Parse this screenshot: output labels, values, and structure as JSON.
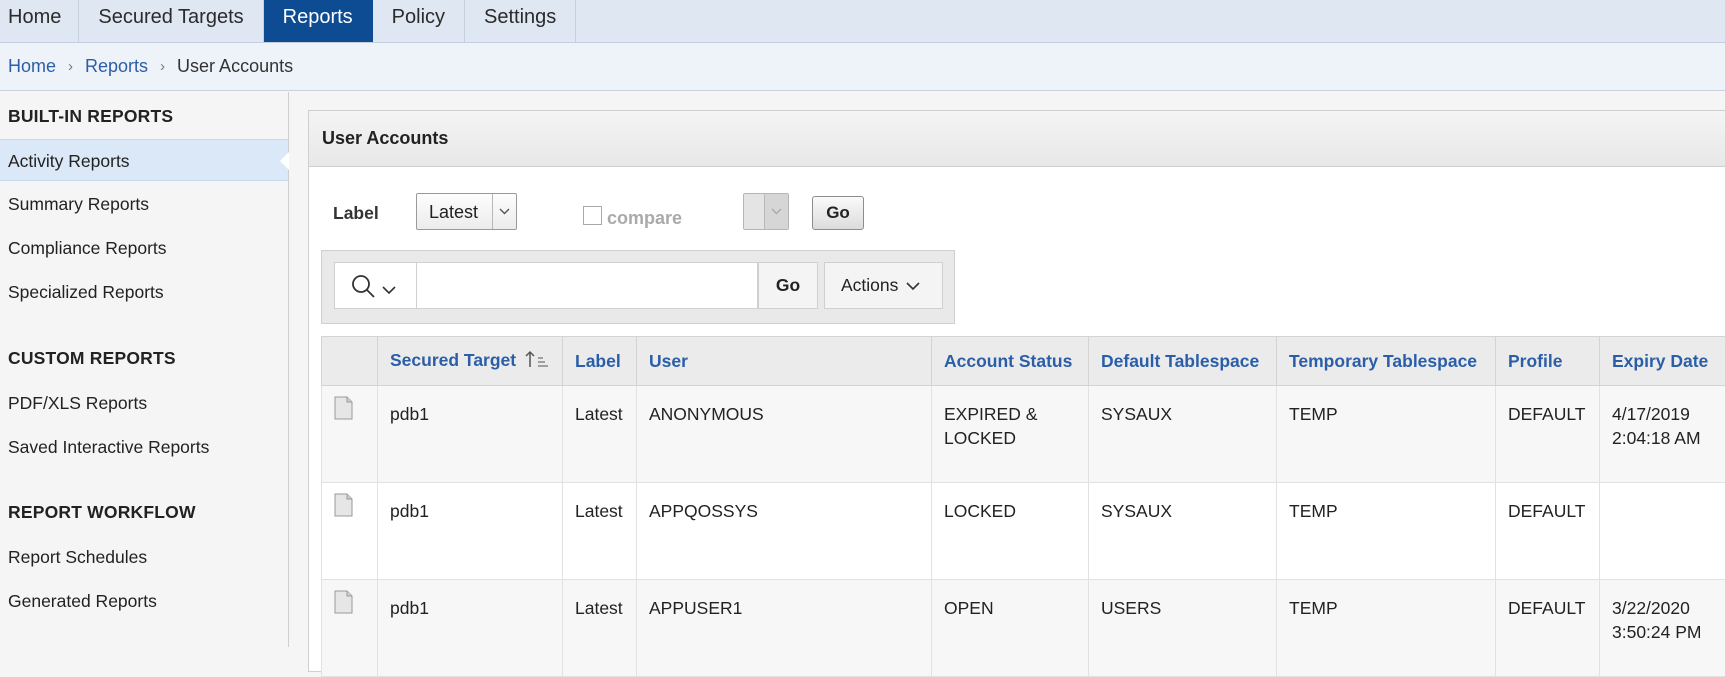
{
  "nav": {
    "tabs": [
      {
        "label": "Home"
      },
      {
        "label": "Secured Targets"
      },
      {
        "label": "Reports"
      },
      {
        "label": "Policy"
      },
      {
        "label": "Settings"
      }
    ]
  },
  "breadcrumb": {
    "home": "Home",
    "reports": "Reports",
    "current": "User Accounts",
    "separator": "›"
  },
  "sidebar": {
    "builtin_heading": "BUILT-IN REPORTS",
    "builtin_items": [
      "Activity Reports",
      "Summary Reports",
      "Compliance Reports",
      "Specialized Reports"
    ],
    "custom_heading": "CUSTOM REPORTS",
    "custom_items": [
      "PDF/XLS Reports",
      "Saved Interactive Reports"
    ],
    "workflow_heading": "REPORT WORKFLOW",
    "workflow_items": [
      "Report Schedules",
      "Generated Reports"
    ]
  },
  "region": {
    "title": "User Accounts",
    "label_text": "Label",
    "label_value": "Latest",
    "compare_label": "compare",
    "go_label": "Go"
  },
  "search": {
    "go_label": "Go",
    "actions_label": "Actions",
    "icon": "search-icon"
  },
  "table": {
    "columns": [
      "Secured Target",
      "Label",
      "User",
      "Account Status",
      "Default Tablespace",
      "Temporary Tablespace",
      "Profile",
      "Expiry Date"
    ],
    "rows": [
      {
        "target": "pdb1",
        "label": "Latest",
        "user": "ANONYMOUS",
        "status_line1": "EXPIRED &",
        "status_line2": "LOCKED",
        "default_ts": "SYSAUX",
        "temp_ts": "TEMP",
        "profile": "DEFAULT",
        "expiry_line1": "4/17/2019",
        "expiry_line2": "2:04:18 AM"
      },
      {
        "target": "pdb1",
        "label": "Latest",
        "user": "APPQOSSYS",
        "status_line1": "LOCKED",
        "status_line2": "",
        "default_ts": "SYSAUX",
        "temp_ts": "TEMP",
        "profile": "DEFAULT",
        "expiry_line1": "",
        "expiry_line2": ""
      },
      {
        "target": "pdb1",
        "label": "Latest",
        "user": "APPUSER1",
        "status_line1": "OPEN",
        "status_line2": "",
        "default_ts": "USERS",
        "temp_ts": "TEMP",
        "profile": "DEFAULT",
        "expiry_line1": "3/22/2020",
        "expiry_line2": "3:50:24 PM"
      }
    ]
  },
  "colors": {
    "active_tab": "#0d4b92",
    "link": "#2b5ea8",
    "sidebar_active": "#dbe8f7"
  }
}
